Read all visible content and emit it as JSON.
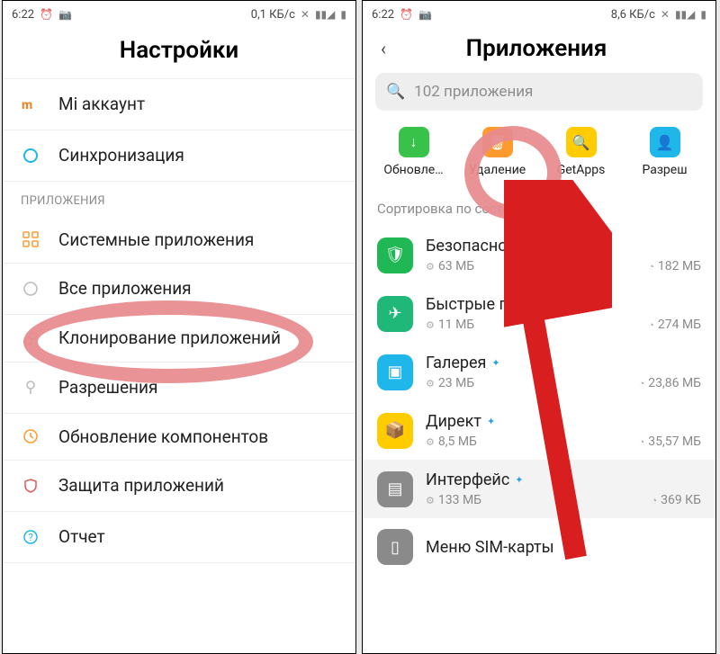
{
  "status_left": {
    "time": "6:22",
    "net": "0,1 КБ/с"
  },
  "status_right": {
    "time": "6:22",
    "net": "8,6 КБ/с"
  },
  "settings": {
    "title": "Настройки",
    "rows": [
      {
        "label": "Mi аккаунт"
      },
      {
        "label": "Синхронизация"
      }
    ],
    "section": "ПРИЛОЖЕНИЯ",
    "apps_rows": [
      {
        "label": "Системные приложения"
      },
      {
        "label": "Все приложения"
      },
      {
        "label": "Клонирование приложений"
      },
      {
        "label": "Разрешения"
      },
      {
        "label": "Обновление компонентов"
      },
      {
        "label": "Защита приложений"
      },
      {
        "label": "Отчет"
      }
    ]
  },
  "apps": {
    "title": "Приложения",
    "search": "102 приложения",
    "quick": [
      {
        "label": "Обновле…",
        "color": "#39c24a"
      },
      {
        "label": "Удаление",
        "color": "#ff9a2e"
      },
      {
        "label": "GetApps",
        "color": "#ffcc00"
      },
      {
        "label": "Разреш",
        "color": "#1fb6ea"
      }
    ],
    "sort": "Сортировка по состоянию ∨",
    "list": [
      {
        "name": "Безопасность",
        "color": "#1fb855",
        "storage": "63 МБ",
        "data": "182 МБ"
      },
      {
        "name": "Быстрые приложения",
        "color": "#1fb879",
        "storage": "11 МБ",
        "data": "274 МБ"
      },
      {
        "name": "Галерея",
        "color": "#1fb6ea",
        "storage": "23 МБ",
        "data": "23,86 МБ"
      },
      {
        "name": "Директ",
        "color": "#ffcc00",
        "storage": "8,5 МБ",
        "data": "35,57 МБ"
      },
      {
        "name": "Интерфейс",
        "color": "#9e9e9e",
        "storage": "133 МБ",
        "data": "369 КБ"
      },
      {
        "name": "Меню SIM-карты",
        "color": "#8a8a8a",
        "storage": "",
        "data": ""
      }
    ]
  }
}
